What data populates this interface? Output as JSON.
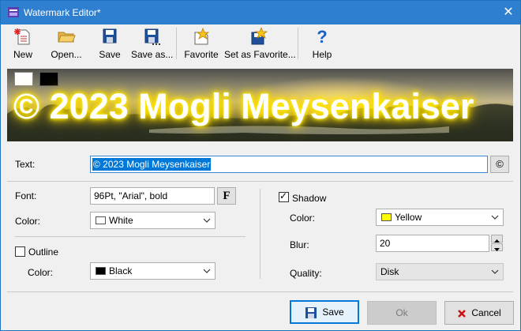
{
  "window": {
    "title": "Watermark Editor*",
    "close_glyph": "✕"
  },
  "toolbar": {
    "new": "New",
    "open": "Open...",
    "save": "Save",
    "save_as": "Save as...",
    "favorite": "Favorite",
    "set_as_favorite": "Set as Favorite...",
    "help": "Help"
  },
  "preview": {
    "watermark_text": "© 2023 Mogli Meysenkaiser",
    "swatches": [
      "#ffffff",
      "#000000"
    ]
  },
  "text_section": {
    "label": "Text:",
    "value": "© 2023 Mogli Meysenkaiser",
    "copyright_button": "©"
  },
  "font_section": {
    "font_label": "Font:",
    "font_value": "96Pt, \"Arial\", bold",
    "font_button": "F",
    "color_label": "Color:",
    "color_value": "White",
    "color_swatch": "#ffffff"
  },
  "outline_section": {
    "checkbox_label": "Outline",
    "checked": false,
    "color_label": "Color:",
    "color_value": "Black",
    "color_swatch": "#000000"
  },
  "shadow_section": {
    "checkbox_label": "Shadow",
    "checked": true,
    "color_label": "Color:",
    "color_value": "Yellow",
    "color_swatch": "#ffff00",
    "blur_label": "Blur:",
    "blur_value": "20",
    "quality_label": "Quality:",
    "quality_value": "Disk"
  },
  "footer": {
    "save": "Save",
    "ok": "Ok",
    "cancel": "Cancel"
  },
  "colors": {
    "titlebar": "#2e7fd0",
    "accent": "#0078d7",
    "glow": "#ffee00"
  }
}
